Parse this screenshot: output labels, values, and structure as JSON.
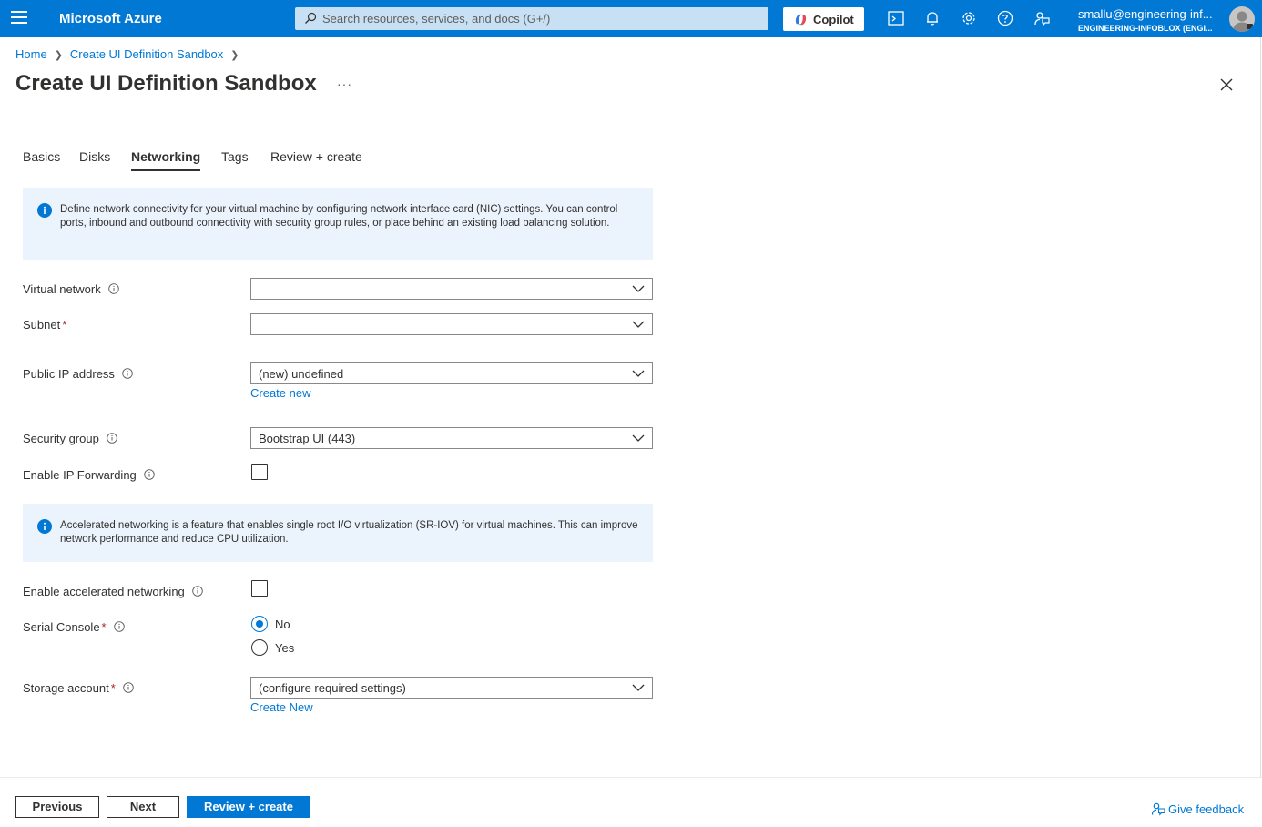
{
  "topbar": {
    "brand": "Microsoft Azure",
    "search_placeholder": "Search resources, services, and docs (G+/)",
    "copilot_label": "Copilot",
    "user_email": "smallu@engineering-inf...",
    "user_directory": "ENGINEERING-INFOBLOX (ENGI...",
    "icons": [
      "cloud-shell-icon",
      "notifications-icon",
      "settings-icon",
      "help-icon",
      "feedback-icon"
    ]
  },
  "breadcrumb": {
    "home": "Home",
    "current": "Create UI Definition Sandbox"
  },
  "page": {
    "title": "Create UI Definition Sandbox",
    "more": "···"
  },
  "tabs": [
    {
      "label": "Basics",
      "active": false
    },
    {
      "label": "Disks",
      "active": false
    },
    {
      "label": "Networking",
      "active": true
    },
    {
      "label": "Tags",
      "active": false
    },
    {
      "label": "Review + create",
      "active": false
    }
  ],
  "info_network": "Define network connectivity for your virtual machine by configuring network interface card (NIC) settings. You can control ports, inbound and outbound connectivity with security group rules, or place behind an existing load balancing solution.",
  "form": {
    "virtual_network": {
      "label": "Virtual network",
      "value": ""
    },
    "subnet": {
      "label": "Subnet",
      "value": ""
    },
    "public_ip": {
      "label": "Public IP address",
      "value": "(new) undefined",
      "link": "Create new"
    },
    "security_group": {
      "label": "Security group",
      "value": "Bootstrap UI (443)"
    },
    "ip_forwarding": {
      "label": "Enable IP Forwarding",
      "checked": false
    },
    "accelerated": {
      "label": "Enable accelerated networking",
      "checked": false
    },
    "serial_console": {
      "label": "Serial Console",
      "options": [
        "No",
        "Yes"
      ],
      "selected": "No"
    },
    "storage_account": {
      "label": "Storage account",
      "value": "(configure required settings)",
      "link": "Create New"
    }
  },
  "info_accelerated": "Accelerated networking is a feature that enables single root I/O virtualization (SR-IOV) for virtual machines. This can improve network performance and reduce CPU utilization.",
  "footer": {
    "previous": "Previous",
    "next": "Next",
    "review_create": "Review + create",
    "feedback": "Give feedback"
  },
  "colors": {
    "azure_blue": "#0078d4",
    "search_bg": "#c7e0f4",
    "info_bg": "#ebf3fc",
    "required": "#a4262c"
  }
}
